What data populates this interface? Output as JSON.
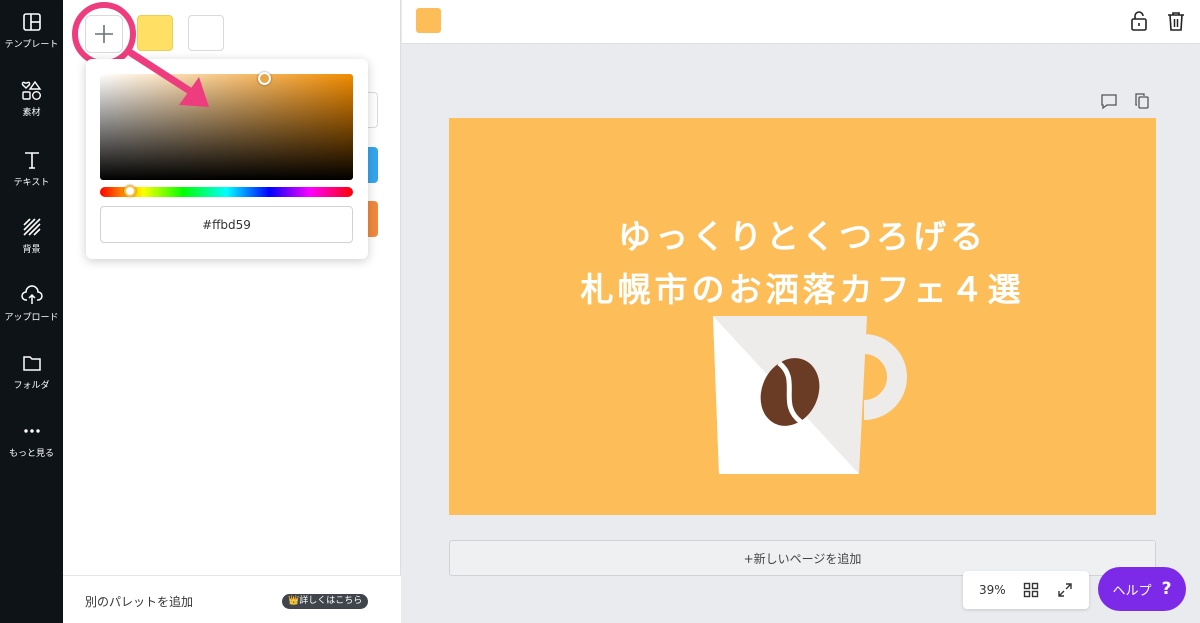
{
  "sidebar": {
    "items": [
      {
        "label": "テンプレート",
        "icon": "template-icon"
      },
      {
        "label": "素材",
        "icon": "elements-icon"
      },
      {
        "label": "テキスト",
        "icon": "text-icon"
      },
      {
        "label": "背景",
        "icon": "background-icon"
      },
      {
        "label": "アップロード",
        "icon": "upload-icon"
      },
      {
        "label": "フォルダ",
        "icon": "folder-icon"
      },
      {
        "label": "もっと見る",
        "icon": "more-icon"
      }
    ]
  },
  "panel": {
    "swatches": [
      "#ffe064",
      "#ffffff"
    ],
    "picker": {
      "hex_value": "#ffbd59",
      "hue_color": "#f18b00"
    },
    "footer": {
      "add_palette_label": "別のパレットを追加",
      "pro_badge": "👑詳しくはこちら"
    }
  },
  "toolbar": {
    "current_color": "#fdbe59",
    "icons": [
      "unlock-icon",
      "trash-icon"
    ]
  },
  "design": {
    "background_color": "#fdbe59",
    "headline_line1": "ゆっくりとくつろげる",
    "headline_line2": "札幌市のお洒落カフェ４選"
  },
  "canvas": {
    "add_page_label": "+新しいページを追加",
    "zoom": "39%",
    "help_label": "ヘルプ",
    "help_mark": "?"
  },
  "annotation": {
    "highlight_color": "#ee3d7f"
  }
}
